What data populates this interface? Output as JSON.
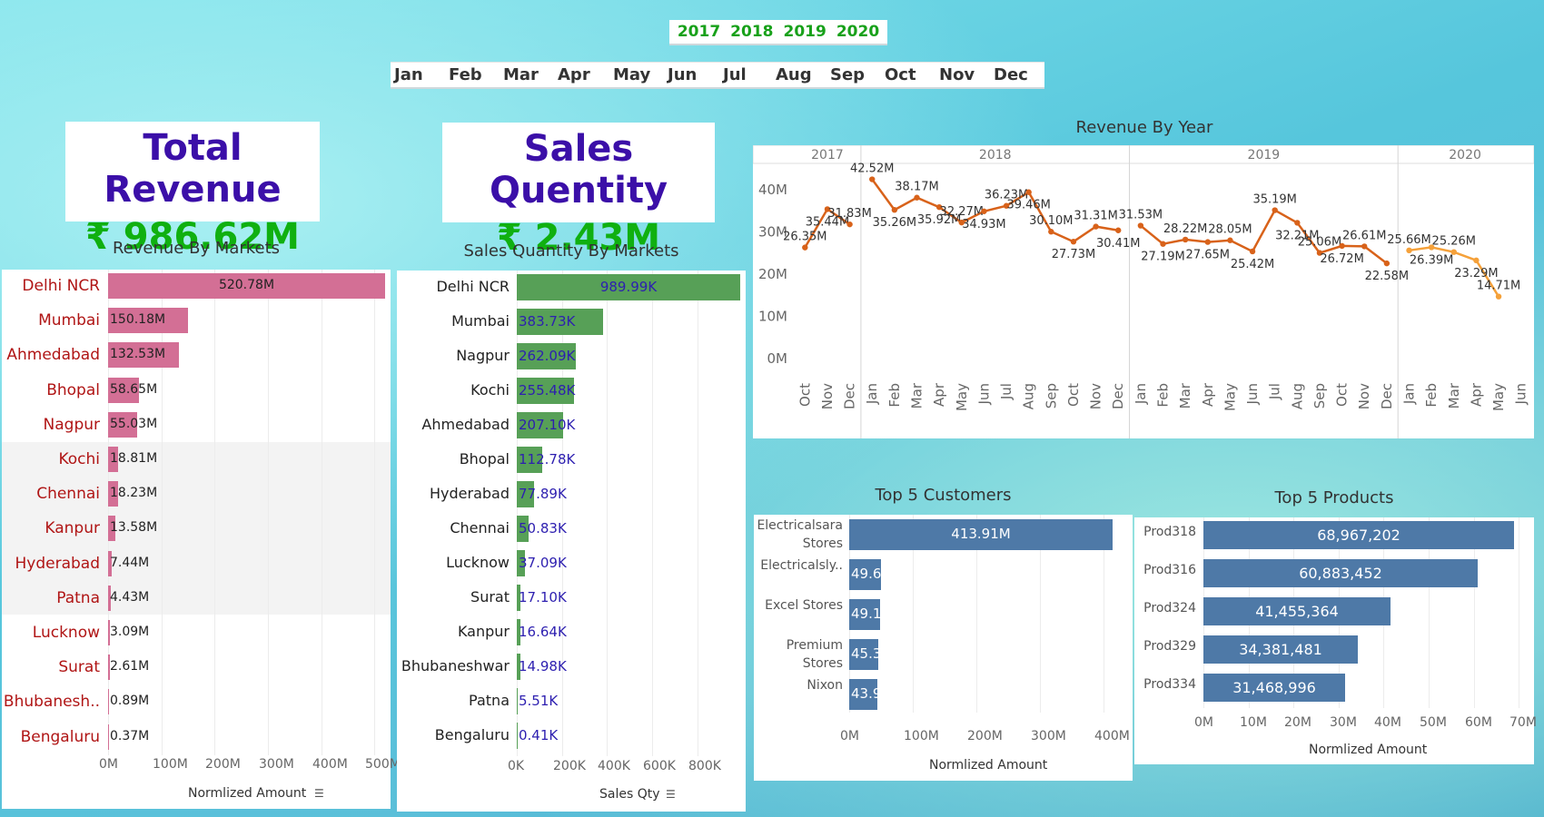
{
  "filters": {
    "years": [
      "2017",
      "2018",
      "2019",
      "2020"
    ],
    "months": [
      "Jan",
      "Feb",
      "Mar",
      "Apr",
      "May",
      "Jun",
      "Jul",
      "Aug",
      "Sep",
      "Oct",
      "Nov",
      "Dec"
    ]
  },
  "kpis": {
    "revenue_title": "Total Revenue",
    "revenue_value": "₹ 986.62M",
    "quantity_title": "Sales Quentity",
    "quantity_value": "₹ 2.43M"
  },
  "colors": {
    "revenue_bar": "#d36f95",
    "revenue_label": "#b01515",
    "quantity_bar": "#57a057",
    "quantity_value": "#2d1fb0",
    "line_dark": "#d8621a",
    "line_light": "#f5a13a",
    "blue_bar": "#4e79a7"
  },
  "chart_data": [
    {
      "id": "revenue_by_markets",
      "type": "bar",
      "title": "Revenue By Markets",
      "xlabel": "Normlized Amount",
      "categories": [
        "Delhi NCR",
        "Mumbai",
        "Ahmedabad",
        "Bhopal",
        "Nagpur",
        "Kochi",
        "Chennai",
        "Kanpur",
        "Hyderabad",
        "Patna",
        "Lucknow",
        "Surat",
        "Bhubanesh..",
        "Bengaluru"
      ],
      "values": [
        520.78,
        150.18,
        132.53,
        58.65,
        55.03,
        18.81,
        18.23,
        13.58,
        7.44,
        4.43,
        3.09,
        2.61,
        0.89,
        0.37
      ],
      "value_labels": [
        "520.78M",
        "150.18M",
        "132.53M",
        "58.65M",
        "55.03M",
        "18.81M",
        "18.23M",
        "13.58M",
        "7.44M",
        "4.43M",
        "3.09M",
        "2.61M",
        "0.89M",
        "0.37M"
      ],
      "ticks": [
        "0M",
        "100M",
        "200M",
        "300M",
        "400M",
        "500M"
      ],
      "xlim": [
        0,
        520
      ]
    },
    {
      "id": "sales_quantity_by_markets",
      "type": "bar",
      "title": "Sales Quantity By Markets",
      "xlabel": "Sales Qty",
      "categories": [
        "Delhi NCR",
        "Mumbai",
        "Nagpur",
        "Kochi",
        "Ahmedabad",
        "Bhopal",
        "Hyderabad",
        "Chennai",
        "Lucknow",
        "Surat",
        "Kanpur",
        "Bhubaneshwar",
        "Patna",
        "Bengaluru"
      ],
      "values": [
        989.99,
        383.73,
        262.09,
        255.48,
        207.1,
        112.78,
        77.89,
        50.83,
        37.09,
        17.1,
        16.64,
        14.98,
        5.51,
        0.41
      ],
      "value_labels": [
        "989.99K",
        "383.73K",
        "262.09K",
        "255.48K",
        "207.10K",
        "112.78K",
        "77.89K",
        "50.83K",
        "37.09K",
        "17.10K",
        "16.64K",
        "14.98K",
        "5.51K",
        "0.41K"
      ],
      "ticks": [
        "0K",
        "200K",
        "400K",
        "600K",
        "800K"
      ],
      "xlim": [
        0,
        990
      ]
    },
    {
      "id": "revenue_by_year",
      "type": "line",
      "title": "Revenue By Year",
      "ylim": [
        0,
        45
      ],
      "yticks": [
        "40M",
        "30M",
        "20M",
        "10M",
        "0M"
      ],
      "ytick_values": [
        40,
        30,
        20,
        10,
        0
      ],
      "years": [
        {
          "year": "2017",
          "months": [
            "Oct",
            "Nov",
            "Dec"
          ],
          "values": [
            26.35,
            35.44,
            31.83
          ],
          "labels": [
            "26.35M",
            "35.44M",
            "31.83M"
          ]
        },
        {
          "year": "2018",
          "months": [
            "Jan",
            "Feb",
            "Mar",
            "Apr",
            "May",
            "Jun",
            "Jul",
            "Aug",
            "Sep",
            "Oct",
            "Nov",
            "Dec"
          ],
          "values": [
            42.52,
            35.26,
            38.17,
            35.92,
            32.27,
            34.93,
            36.23,
            39.46,
            30.1,
            27.73,
            31.31,
            30.41
          ],
          "labels": [
            "42.52M",
            "35.26M",
            "38.17M",
            "35.92M",
            "32.27M",
            "34.93M",
            "36.23M",
            "39.46M",
            "30.10M",
            "27.73M",
            "31.31M",
            "30.41M"
          ]
        },
        {
          "year": "2019",
          "months": [
            "Jan",
            "Feb",
            "Mar",
            "Apr",
            "May",
            "Jun",
            "Jul",
            "Aug",
            "Sep",
            "Oct",
            "Nov",
            "Dec"
          ],
          "values": [
            31.53,
            27.19,
            28.22,
            27.65,
            28.05,
            25.42,
            35.19,
            32.21,
            25.06,
            26.72,
            26.61,
            22.58
          ],
          "labels": [
            "31.53M",
            "27.19M",
            "28.22M",
            "27.65M",
            "28.05M",
            "25.42M",
            "35.19M",
            "32.21M",
            "25.06M",
            "26.72M",
            "26.61M",
            "22.58M"
          ]
        },
        {
          "year": "2020",
          "months": [
            "Jan",
            "Feb",
            "Mar",
            "Apr",
            "May",
            "Jun"
          ],
          "values": [
            25.66,
            26.39,
            25.26,
            23.29,
            14.71
          ],
          "labels": [
            "25.66M",
            "26.39M",
            "25.26M",
            "23.29M",
            "14.71M"
          ]
        }
      ]
    },
    {
      "id": "top_5_customers",
      "type": "bar",
      "title": "Top 5 Customers",
      "xlabel": "Normlized Amount",
      "categories": [
        "Electricalsara Stores",
        "Electricalsly..",
        "Excel Stores",
        "Premium Stores",
        "Nixon"
      ],
      "values": [
        413.91,
        49.6,
        49.1,
        45.3,
        43.9
      ],
      "value_labels": [
        "413.91M",
        "49.6",
        "49.1",
        "45.3",
        "43.9"
      ],
      "ticks": [
        "0M",
        "100M",
        "200M",
        "300M",
        "400M"
      ],
      "xlim": [
        0,
        440
      ]
    },
    {
      "id": "top_5_products",
      "type": "bar",
      "title": "Top 5 Products",
      "xlabel": "Normlized Amount",
      "categories": [
        "Prod318",
        "Prod316",
        "Prod324",
        "Prod329",
        "Prod334"
      ],
      "values": [
        68.967202,
        60.883452,
        41.455364,
        34.381481,
        31.468996
      ],
      "value_labels": [
        "68,967,202",
        "60,883,452",
        "41,455,364",
        "34,381,481",
        "31,468,996"
      ],
      "ticks": [
        "0M",
        "10M",
        "20M",
        "30M",
        "40M",
        "50M",
        "60M",
        "70M"
      ],
      "xlim": [
        0,
        72
      ]
    }
  ]
}
